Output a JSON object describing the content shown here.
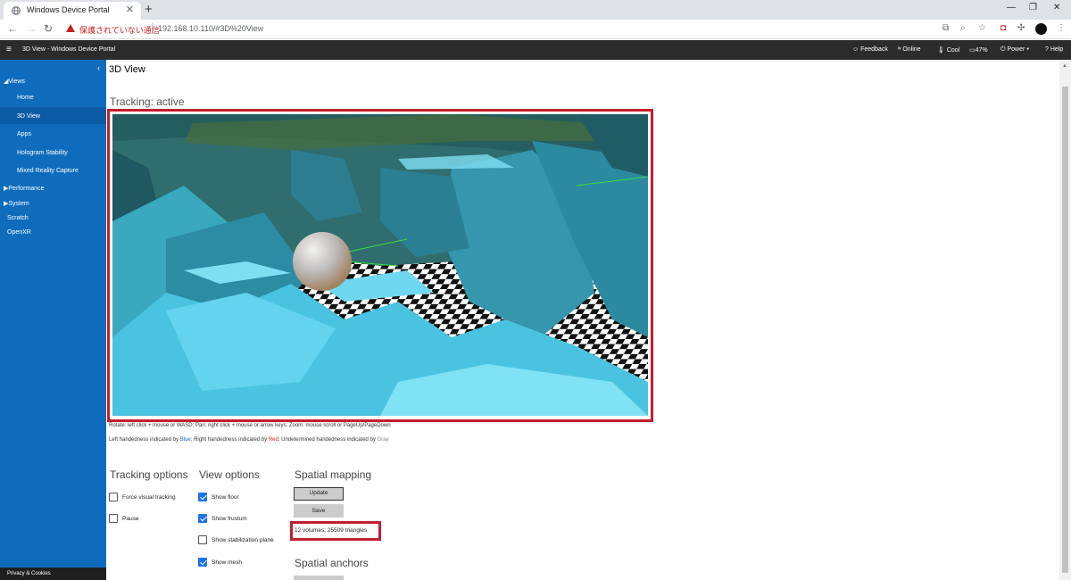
{
  "browser": {
    "tab_title": "Windows Device Portal",
    "tab_close": "✕",
    "new_tab": "+",
    "insecure_label": "保護されていない通信",
    "url": "192.168.10.110/#3D%20View"
  },
  "header": {
    "menu_glyph": "≡",
    "title": "3D View - Windows Device Portal",
    "feedback": "Feedback",
    "online": "Online",
    "temperature": "Cool",
    "battery": "47%",
    "power": "Power",
    "help": "Help"
  },
  "sidebar": {
    "collapse_glyph": "‹",
    "views": "◢Views",
    "items": [
      "Home",
      "3D View",
      "Apps",
      "Hologram Stability",
      "Mixed Reality Capture"
    ],
    "performance": "▶Performance",
    "system": "▶System",
    "scratch": "Scratch",
    "openxr": "OpenXR",
    "privacy": "Privacy & Cookies"
  },
  "main": {
    "title": "3D View",
    "tracking_status": "Tracking: active",
    "hint_controls": "Rotate: left click + mouse or WASD; Pan: right click + mouse or arrow keys; Zoom: mouse scroll or PageUp/PageDown",
    "hint_hand_prefix": "Left handedness indicated by ",
    "hint_hand_blue": "Blue",
    "hint_hand_mid": "; Right handedness indicated by ",
    "hint_hand_red": "Red",
    "hint_hand_mid2": "; Undetermined handedness indicated by ",
    "hint_hand_gray": "Gray",
    "tracking_options": {
      "title": "Tracking options",
      "items": [
        {
          "label": "Force visual tracking",
          "checked": false
        },
        {
          "label": "Pause",
          "checked": false
        }
      ]
    },
    "view_options": {
      "title": "View options",
      "items": [
        {
          "label": "Show floor",
          "checked": true
        },
        {
          "label": "Show frustum",
          "checked": true
        },
        {
          "label": "Show stabilization plane",
          "checked": false
        },
        {
          "label": "Show mesh",
          "checked": true
        }
      ]
    },
    "spatial_mapping": {
      "title": "Spatial mapping",
      "update_label": "Update",
      "save_label": "Save",
      "stats": "12 volumes; 25509 triangles"
    },
    "spatial_anchors": {
      "title": "Spatial anchors"
    }
  }
}
